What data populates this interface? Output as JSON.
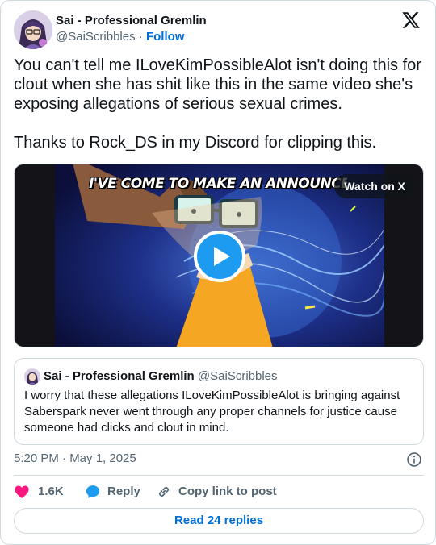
{
  "author": {
    "display_name": "Sai - Professional Gremlin",
    "handle": "@SaiScribbles",
    "separator": "·",
    "follow_label": "Follow"
  },
  "tweet": {
    "text": "You can't tell me ILoveKimPossibleAlot isn't doing this for clout when she has shit like this in the same video she's exposing allegations of serious sexual crimes.\n\nThanks to Rock_DS in my Discord for clipping this."
  },
  "video": {
    "caption": "I'VE COME TO MAKE AN ANNOUNCEMENT",
    "watch_label": "Watch on X"
  },
  "quote": {
    "display_name": "Sai - Professional Gremlin",
    "handle": "@SaiScribbles",
    "text": "I worry that these allegations ILoveKimPossibleAlot is bringing against Saberspark never went through any proper channels for justice cause someone had clicks and clout in mind."
  },
  "meta": {
    "timestamp": "5:20 PM · May 1, 2025"
  },
  "actions": {
    "like_count": "1.6K",
    "reply_label": "Reply",
    "copy_label": "Copy link to post"
  },
  "read_replies_label": "Read 24 replies",
  "colors": {
    "link_blue": "#006fd6",
    "heart_pink": "#f91880",
    "reply_blue": "#1d9bf0",
    "text_gray": "#536471"
  }
}
